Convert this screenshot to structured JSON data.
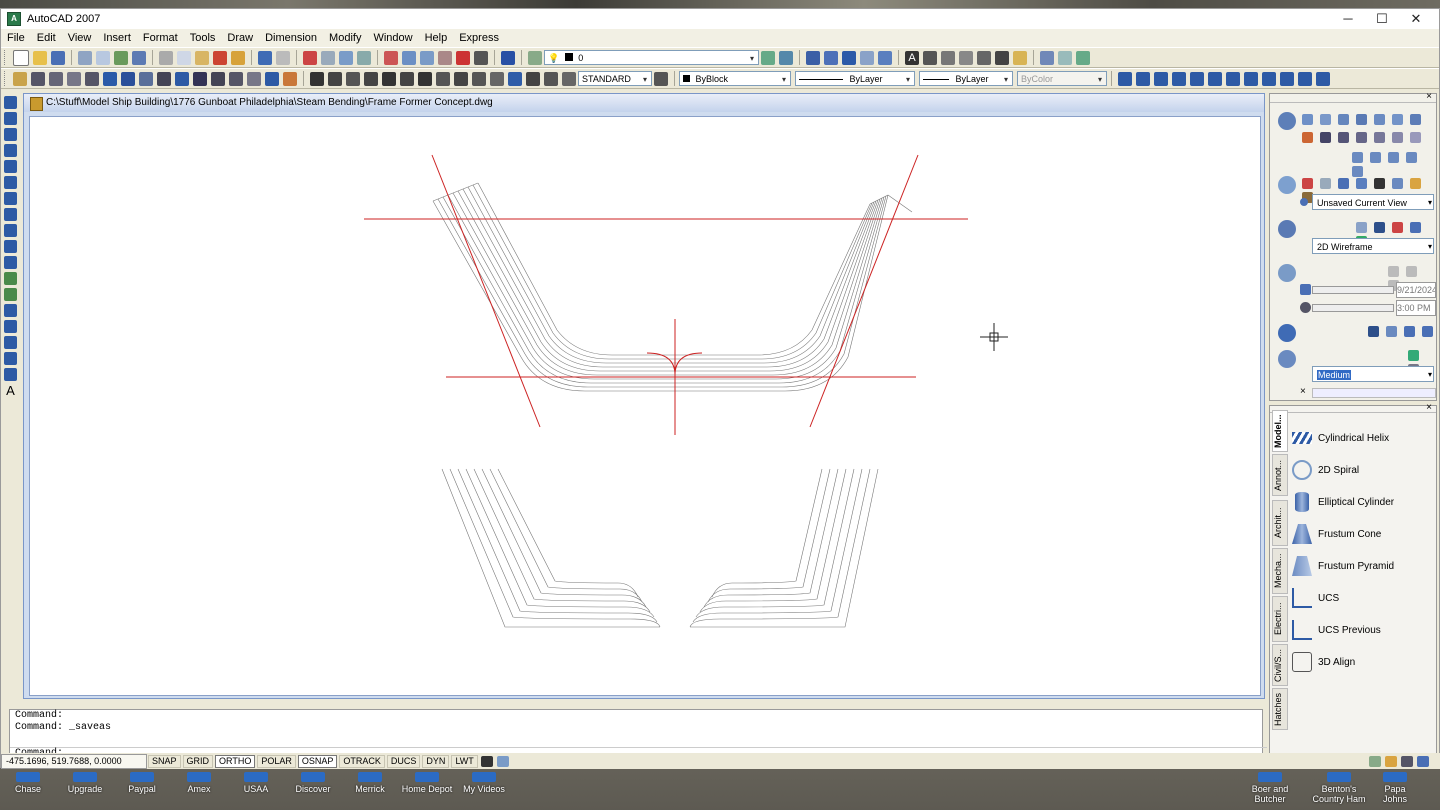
{
  "app": {
    "title": "AutoCAD 2007",
    "minimize": "─",
    "maximize": "☐",
    "close": "✕"
  },
  "menu": [
    "File",
    "Edit",
    "View",
    "Insert",
    "Format",
    "Tools",
    "Draw",
    "Dimension",
    "Modify",
    "Window",
    "Help",
    "Express"
  ],
  "toolbar": {
    "layer": "0",
    "text_style": "STANDARD",
    "color": "ByBlock",
    "linetype": "ByLayer",
    "lineweight": "ByLayer",
    "plotstyle": "ByColor"
  },
  "drawing": {
    "path": "C:\\Stuff\\Model Ship Building\\1776 Gunboat Philadelphia\\Steam Bending\\Frame Former Concept.dwg"
  },
  "palette": {
    "view": "Unsaved Current View",
    "visual_style": "2D Wireframe",
    "date": "9/21/2024",
    "time": "3:00 PM",
    "quality": "Medium"
  },
  "tool_palette": {
    "tabs": [
      "Model...",
      "Annot...",
      "Archit...",
      "Mecha...",
      "Electri...",
      "Civil/S...",
      "Hatches"
    ],
    "tools": [
      "Cylindrical Helix",
      "2D Spiral",
      "Elliptical Cylinder",
      "Frustum Cone",
      "Frustum Pyramid",
      "UCS",
      "UCS Previous",
      "3D Align"
    ]
  },
  "command": {
    "history": [
      "Command:",
      "Command: _saveas"
    ],
    "prompt": "Command:"
  },
  "status": {
    "coords": "-475.1696, 519.7688, 0.0000",
    "toggles": [
      "SNAP",
      "GRID",
      "ORTHO",
      "POLAR",
      "OSNAP",
      "OTRACK",
      "DUCS",
      "DYN",
      "LWT"
    ]
  },
  "taskbar": [
    "Chase",
    "Upgrade",
    "Paypal",
    "Amex",
    "USAA",
    "Discover",
    "Merrick",
    "Home Depot",
    "My Videos",
    "Boer and Butcher",
    "Benton's Country Ham",
    "Papa Johns"
  ],
  "colors": {
    "accent": "#cc2222",
    "titlebar_gradient": "#c4d3ec",
    "icon_blue": "#2b6bc4"
  }
}
